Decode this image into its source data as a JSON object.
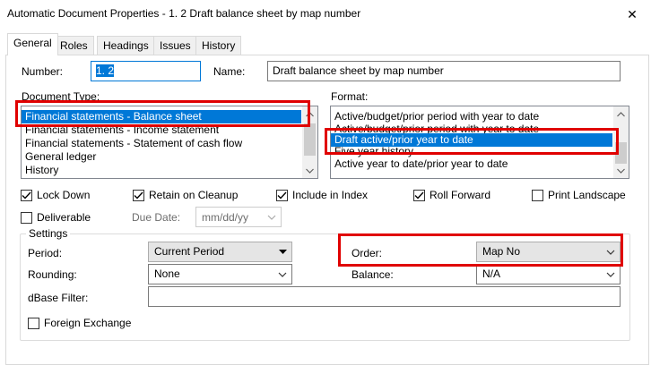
{
  "window": {
    "title": "Automatic Document Properties -  1. 2 Draft balance sheet by map number",
    "close_glyph": "✕"
  },
  "tabs": [
    {
      "label": "General"
    },
    {
      "label": "Roles"
    },
    {
      "label": "Headings"
    },
    {
      "label": "Issues"
    },
    {
      "label": "History"
    }
  ],
  "number": {
    "label": "Number:",
    "value": "1. 2"
  },
  "name": {
    "label": "Name:",
    "value": "Draft balance sheet by map number"
  },
  "document_type": {
    "label": "Document Type:",
    "items": [
      "Financial statements - Balance sheet",
      "Financial statements - Income statement",
      "Financial statements - Statement of cash flow",
      "General ledger",
      "History"
    ]
  },
  "format": {
    "label": "Format:",
    "items": [
      "Active/budget/prior period with year to date",
      "Active/budget/prior period with year to date",
      "Draft active/prior year to date",
      "Five year history",
      "Active year to date/prior year to date"
    ]
  },
  "checkboxes": {
    "lock_down": "Lock Down",
    "retain_on_cleanup": "Retain on Cleanup",
    "include_in_index": "Include in Index",
    "roll_forward": "Roll Forward",
    "print_landscape": "Print Landscape",
    "deliverable": "Deliverable",
    "foreign_exchange": "Foreign Exchange"
  },
  "due_date": {
    "label": "Due Date:",
    "placeholder": "mm/dd/yy"
  },
  "settings": {
    "legend": "Settings",
    "period_label": "Period:",
    "period_value": "Current Period",
    "rounding_label": "Rounding:",
    "rounding_value": "None",
    "dbase_label": "dBase Filter:",
    "order_label": "Order:",
    "order_value": "Map No",
    "balance_label": "Balance:",
    "balance_value": "N/A"
  },
  "colors": {
    "highlight": "#0078d7",
    "annotation_red": "#e00000"
  }
}
